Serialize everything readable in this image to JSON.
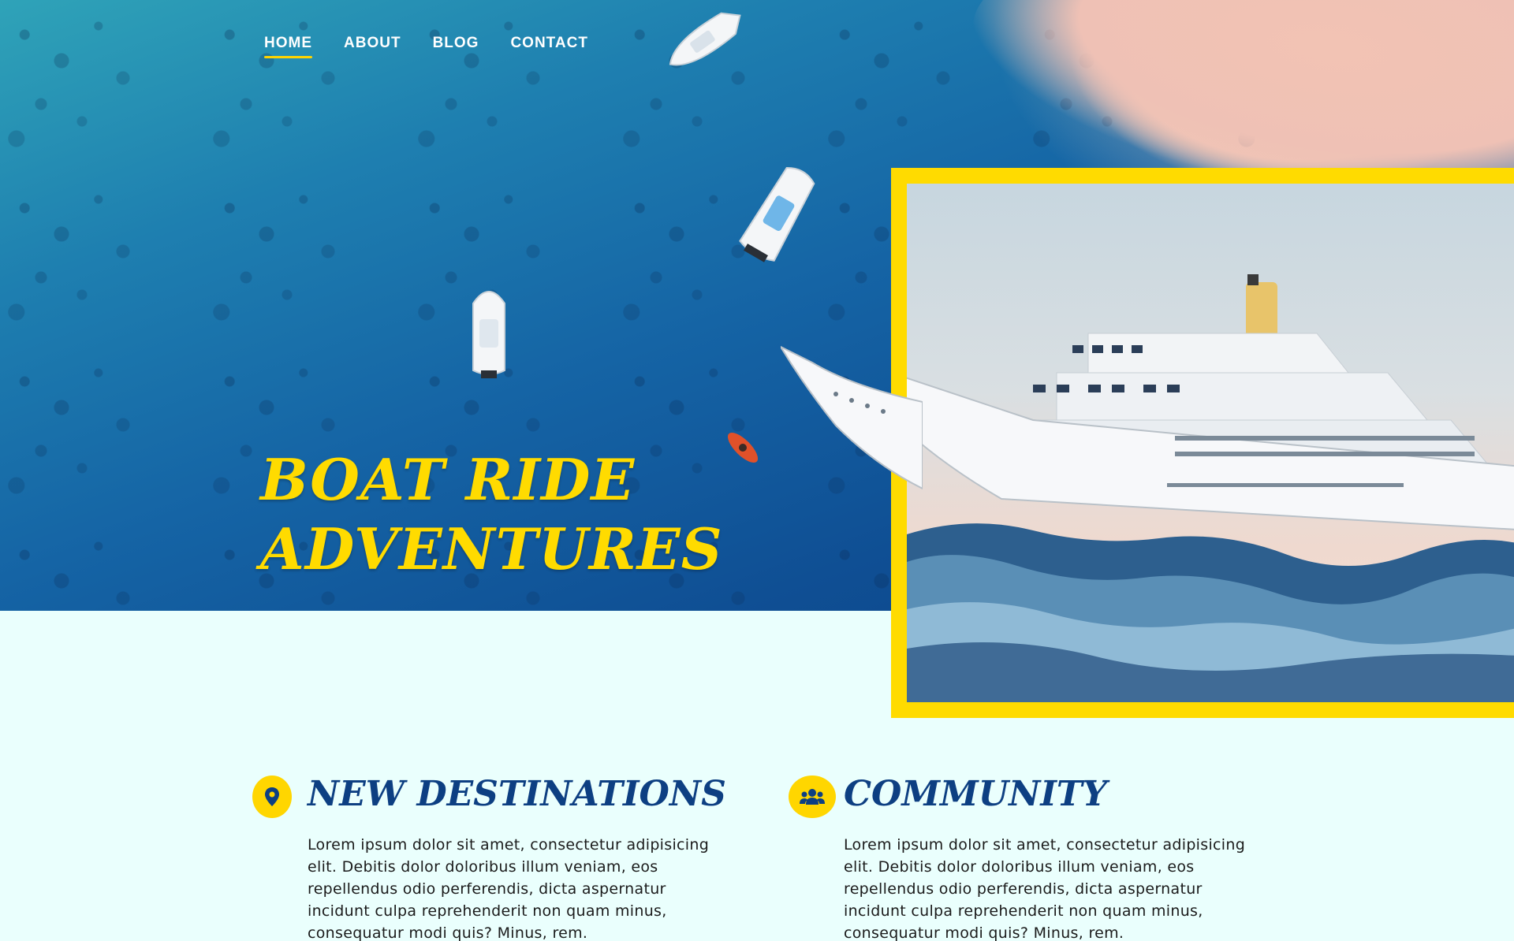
{
  "nav": {
    "items": [
      {
        "label": "HOME",
        "active": true
      },
      {
        "label": "ABOUT",
        "active": false
      },
      {
        "label": "BLOG",
        "active": false
      },
      {
        "label": "CONTACT",
        "active": false
      }
    ]
  },
  "hero": {
    "title_line1": "BOAT RIDE",
    "title_line2": "ADVENTURES"
  },
  "features": [
    {
      "icon": "map-pin-icon",
      "title": "NEW DESTINATIONS",
      "text": "Lorem ipsum dolor sit amet, consectetur adipisicing elit. Debitis dolor doloribus illum veniam, eos repellendus odio perferendis, dicta aspernatur incidunt culpa reprehenderit non quam minus, consequatur modi quis? Minus, rem."
    },
    {
      "icon": "users-icon",
      "title": "COMMUNITY",
      "text": "Lorem ipsum dolor sit amet, consectetur adipisicing elit. Debitis dolor doloribus illum veniam, eos repellendus odio perferendis, dicta aspernatur incidunt culpa reprehenderit non quam minus, consequatur modi quis? Minus, rem."
    }
  ],
  "colors": {
    "accent_yellow": "#ffdb00",
    "title_blue": "#0d3f82",
    "page_background": "#eafffd"
  }
}
